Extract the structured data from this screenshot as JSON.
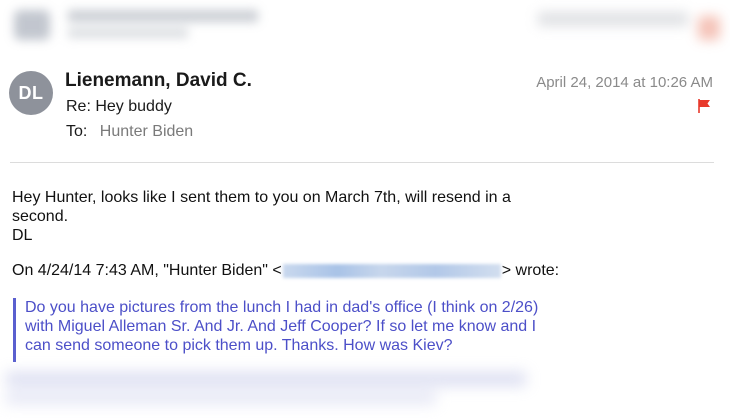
{
  "message": {
    "avatar_initials": "DL",
    "sender": "Lienemann, David C.",
    "subject": "Re: Hey buddy",
    "to_label": "To:",
    "to_value": "Hunter Biden",
    "date": "April 24, 2014 at 10:26 AM",
    "flag_color": "#e8392b"
  },
  "body": {
    "line1": "Hey Hunter, looks like I sent them to you on March 7th, will resend in a second.",
    "signature": "DL"
  },
  "quote": {
    "header_prefix": "On 4/24/14 7:43 AM, \"Hunter Biden\" <",
    "header_suffix": "> wrote:",
    "text": "Do you have pictures from the lunch I had in dad's office (I think on 2/26) with Miguel Alleman Sr. And Jr. And Jeff Cooper? If so let me know and I can send someone to pick them up. Thanks. How was Kiev?",
    "bar_color": "#5a5fcf",
    "text_color": "#4c4fc8"
  }
}
